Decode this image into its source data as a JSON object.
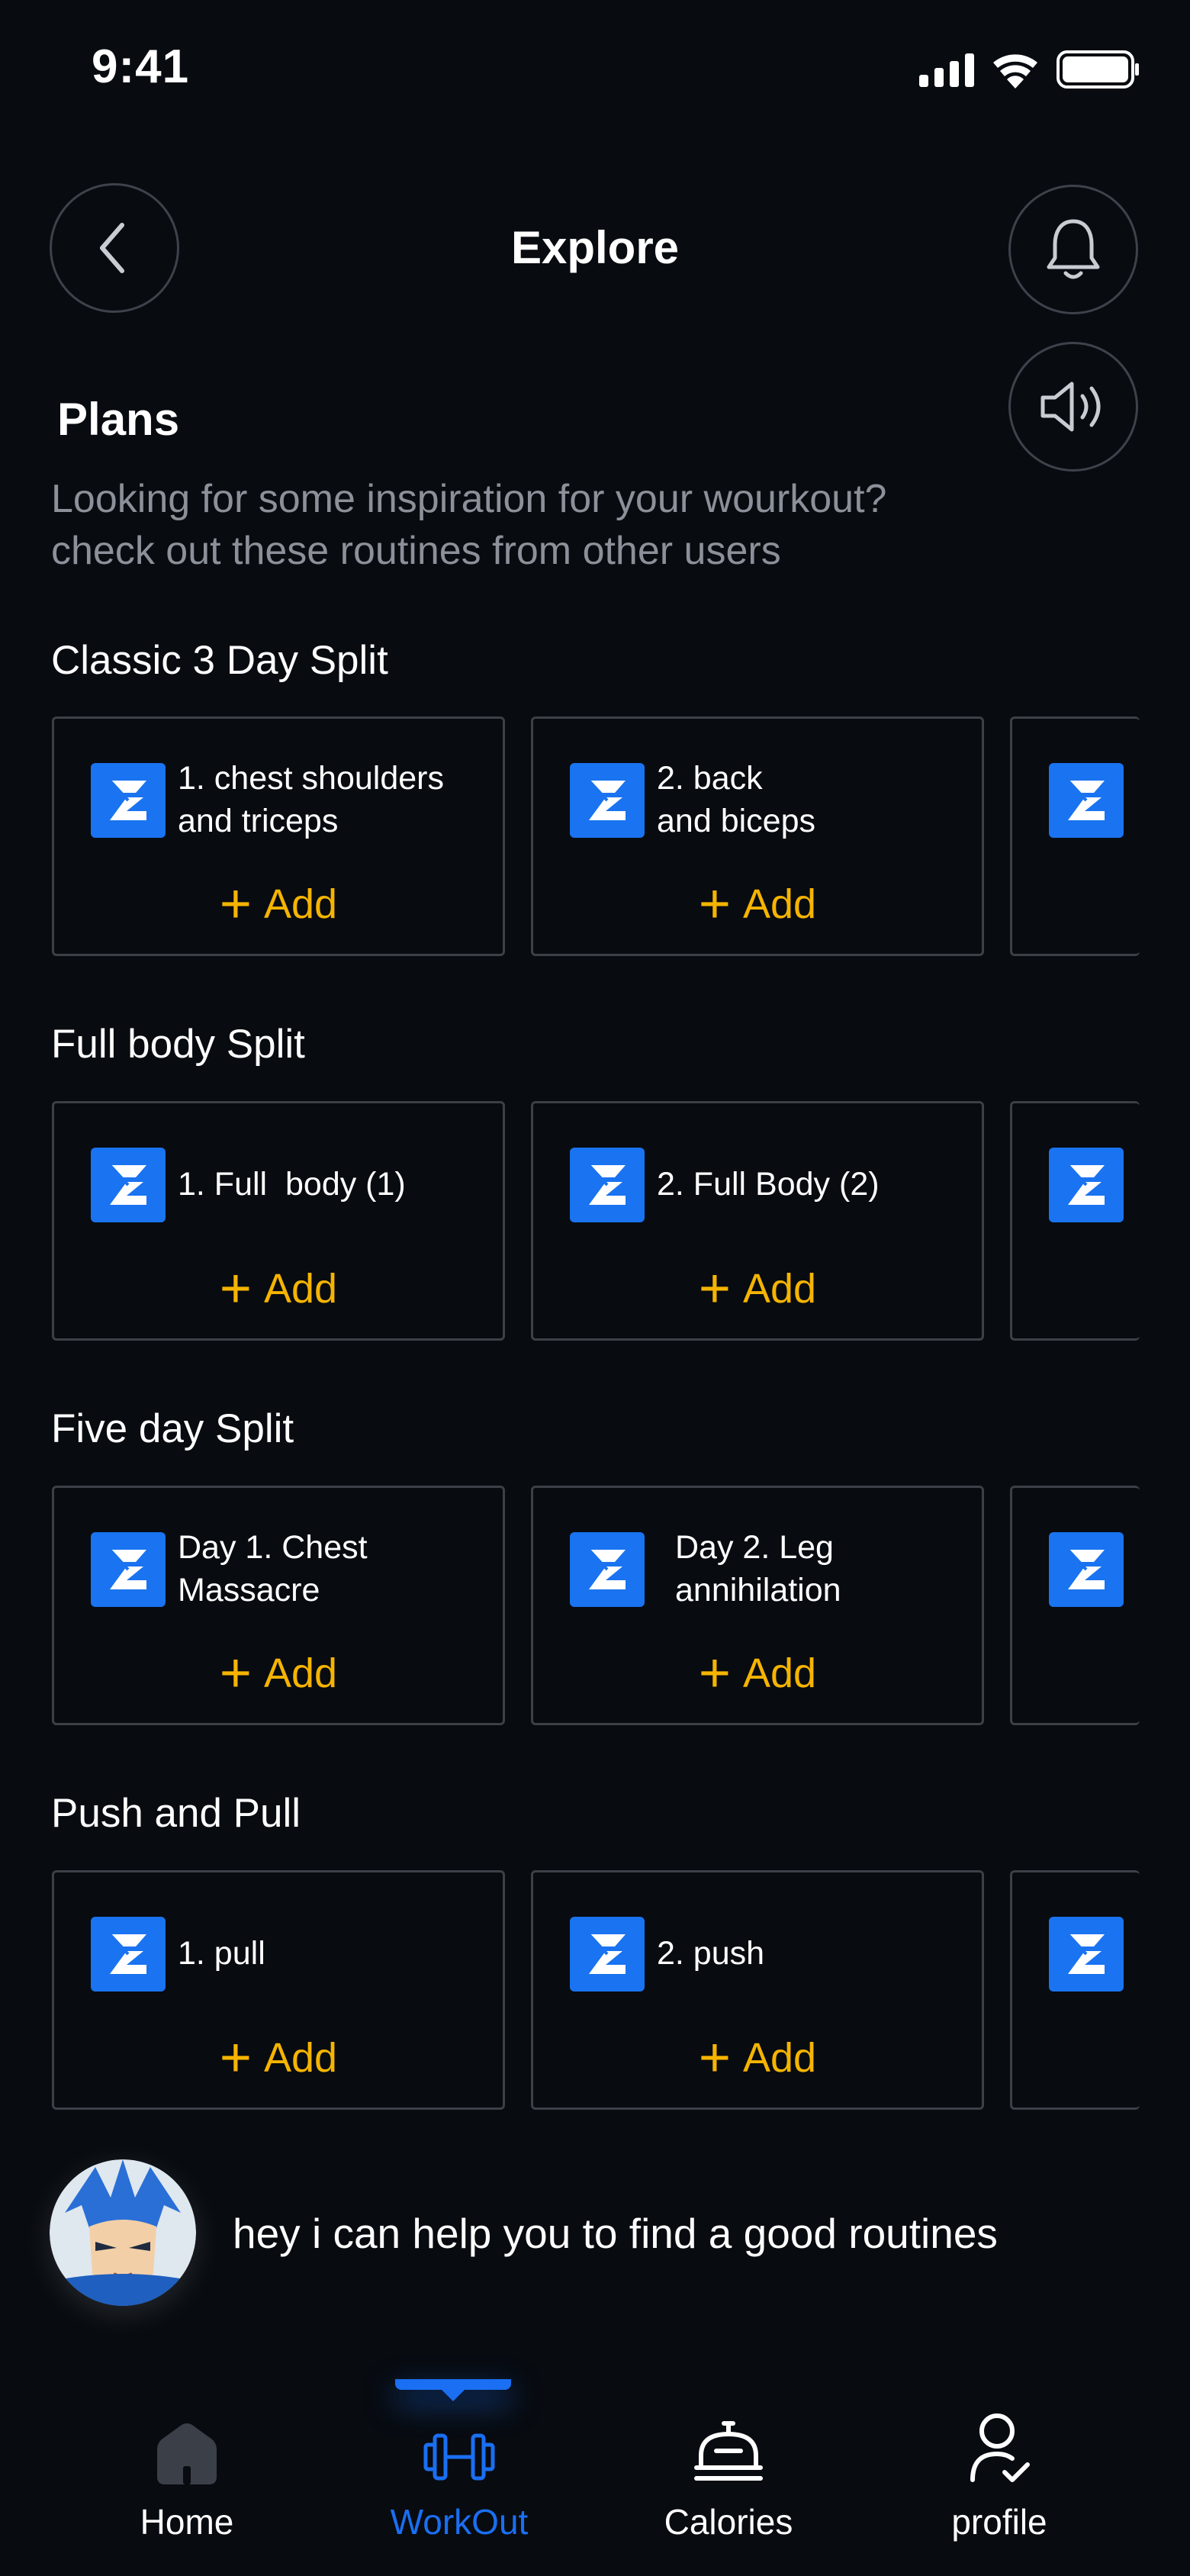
{
  "status_bar": {
    "time": "9:41"
  },
  "header": {
    "title": "Explore"
  },
  "plans": {
    "title": "Plans",
    "subtitle_line1": "Looking for some inspiration for your wourkout?",
    "subtitle_line2": "check out these routines from other users"
  },
  "sections": [
    {
      "title": "Classic 3 Day Split",
      "cards": [
        {
          "label": "1. chest shoulders and triceps",
          "action": "Add"
        },
        {
          "label": "2. back and biceps",
          "action": "Add"
        }
      ]
    },
    {
      "title": "Full body Split",
      "cards": [
        {
          "label": "1. Full  body (1)",
          "action": "Add"
        },
        {
          "label": "2. Full Body (2)",
          "action": "Add"
        }
      ]
    },
    {
      "title": "Five day Split",
      "cards": [
        {
          "label": "Day 1. Chest Massacre",
          "action": "Add"
        },
        {
          "label": "Day 2. Leg annihilation",
          "action": "Add"
        }
      ]
    },
    {
      "title": "Push and Pull",
      "cards": [
        {
          "label": "1. pull",
          "action": "Add"
        },
        {
          "label": "2. push",
          "action": "Add"
        }
      ]
    }
  ],
  "assistant": {
    "message": "hey i can help you to find a good routines"
  },
  "tabbar": {
    "items": [
      {
        "label": "Home",
        "icon": "home-icon"
      },
      {
        "label": "WorkOut",
        "icon": "dumbbell-icon",
        "active": true
      },
      {
        "label": "Calories",
        "icon": "food-cover-icon"
      },
      {
        "label": "profile",
        "icon": "user-check-icon"
      }
    ]
  },
  "colors": {
    "accent": "#1a6ff2",
    "add": "#f5b400",
    "background": "#080b10"
  }
}
